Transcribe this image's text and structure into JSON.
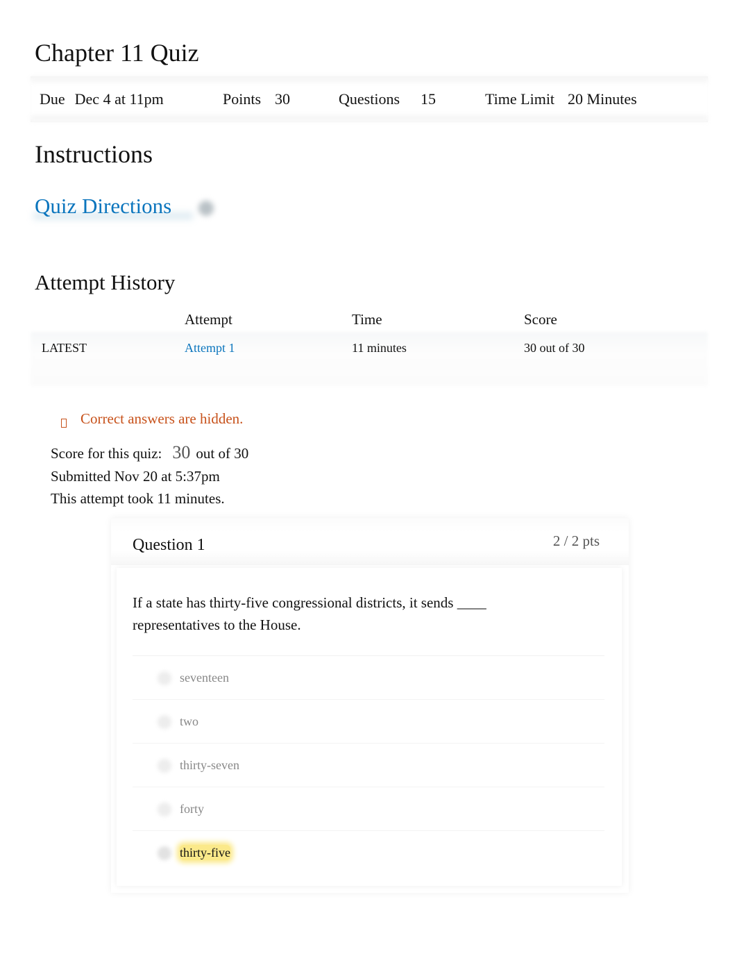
{
  "page": {
    "title": "Chapter 11 Quiz"
  },
  "meta": {
    "due_label": "Due",
    "due_value": "Dec 4 at 11pm",
    "points_label": "Points",
    "points_value": "30",
    "questions_label": "Questions",
    "questions_value": "15",
    "time_limit_label": "Time Limit",
    "time_limit_value": "20 Minutes"
  },
  "instructions": {
    "title": "Instructions",
    "link_label": "Quiz Directions",
    "icon": "expand-icon"
  },
  "attempt_history": {
    "title": "Attempt History",
    "columns": [
      "",
      "Attempt",
      "Time",
      "Score"
    ],
    "rows": [
      {
        "status": "LATEST",
        "attempt": "Attempt 1",
        "time": "11 minutes",
        "score": "30 out of 30"
      }
    ]
  },
  "notice": {
    "icon": "warning-icon",
    "text": "Correct answers are hidden.",
    "color": "#c7511a"
  },
  "summary": {
    "score_label": "Score for this quiz:",
    "score_value": "30",
    "score_suffix": "out of 30",
    "submitted": "Submitted Nov 20 at 5:37pm",
    "duration": "This attempt took 11 minutes."
  },
  "question": {
    "title": "Question 1",
    "points": "2 / 2 pts",
    "text": "If a state has thirty-five congressional districts, it sends ____ representatives to the House.",
    "answers": [
      {
        "label": "seventeen",
        "selected": false
      },
      {
        "label": "two",
        "selected": false
      },
      {
        "label": "thirty-seven",
        "selected": false
      },
      {
        "label": "forty",
        "selected": false
      },
      {
        "label": "thirty-five",
        "selected": true
      }
    ],
    "highlight_color": "#fbe98a"
  },
  "colors": {
    "link": "#0b75bd",
    "text": "#111111",
    "muted": "#888888"
  }
}
